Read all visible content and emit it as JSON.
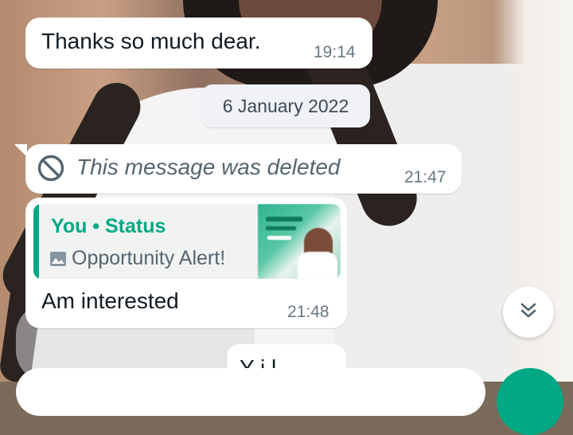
{
  "messages": [
    {
      "text": "Thanks so much dear.",
      "time": "19:14"
    }
  ],
  "date_separator": "6 January 2022",
  "deleted_message": {
    "text": "This message was deleted",
    "time": "21:47",
    "icon": "blocked-icon"
  },
  "reply_message": {
    "quote_author": "You • Status",
    "quote_caption": "Opportunity Alert!",
    "quote_icon": "image-icon",
    "text": "Am interested",
    "time": "21:48"
  },
  "partial_message": {
    "text": "Y  i   l"
  },
  "scroll_button": {
    "icon": "double-chevron-down-icon"
  },
  "colors": {
    "accent": "#06a884",
    "bubble": "#ffffff",
    "time": "#667781"
  }
}
